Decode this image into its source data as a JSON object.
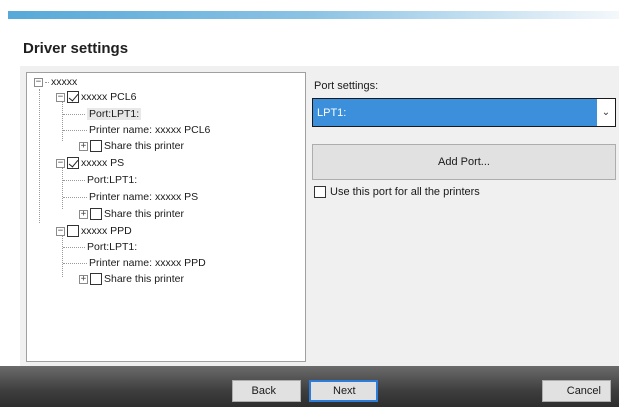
{
  "dialog": {
    "title": "Driver settings"
  },
  "tree": {
    "root": "xxxxx",
    "printers": [
      {
        "name": "xxxxx PCL6",
        "checked": true,
        "port": "Port:LPT1:",
        "printer_name_label": "Printer name:",
        "printer_name_value": "xxxxx PCL6",
        "share": "Share this printer"
      },
      {
        "name": "xxxxx PS",
        "checked": true,
        "port": "Port:LPT1:",
        "printer_name_label": "Printer name:",
        "printer_name_value": "xxxxx PS",
        "share": "Share this printer"
      },
      {
        "name": "xxxxx PPD",
        "checked": false,
        "port": "Port:LPT1:",
        "printer_name_label": "Printer name:",
        "printer_name_value": "xxxxx PPD",
        "share": "Share this printer"
      }
    ]
  },
  "port_settings": {
    "label": "Port settings:",
    "selected": "LPT1:",
    "add_port": "Add Port...",
    "use_for_all": "Use this port for all the printers"
  },
  "buttons": {
    "back": "Back",
    "next": "Next",
    "cancel": "Cancel"
  },
  "colors": {
    "accent": "#3b8fdb",
    "footer": "#3e3e3e"
  }
}
